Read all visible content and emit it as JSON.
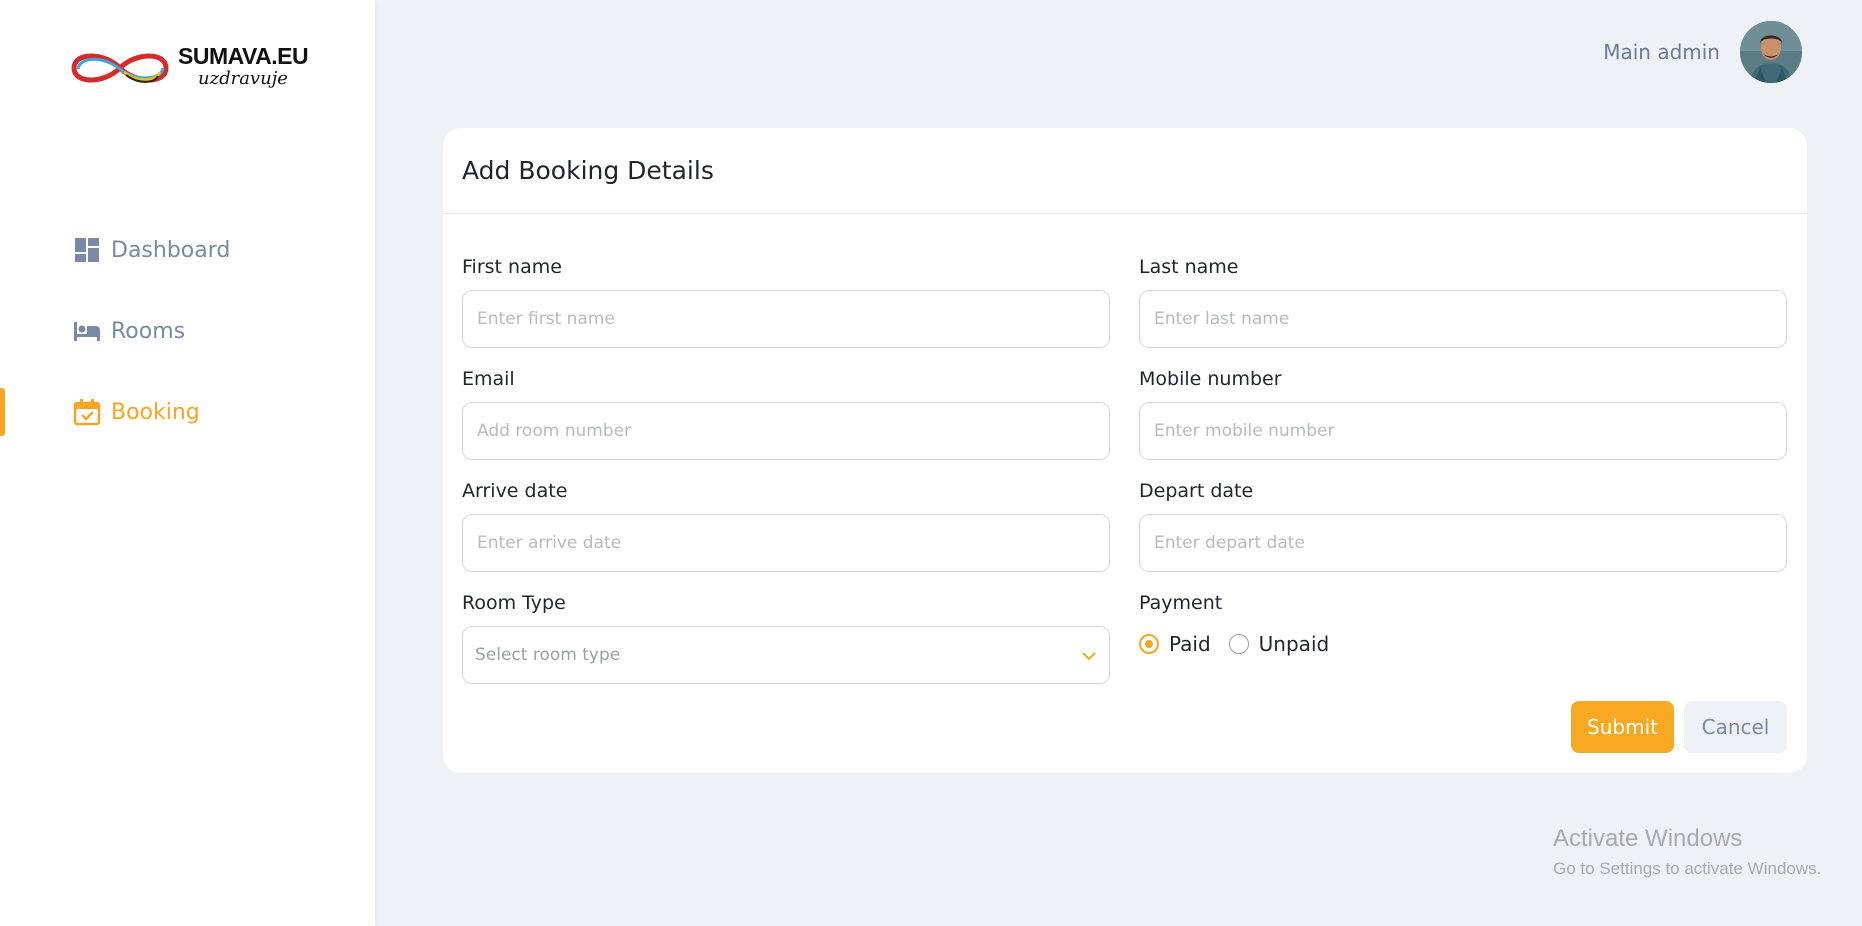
{
  "brand": {
    "title": "SUMAVA.EU",
    "subtitle": "uzdravuje"
  },
  "sidebar": {
    "items": [
      {
        "label": "Dashboard",
        "icon": "dashboard-icon",
        "active": false
      },
      {
        "label": "Rooms",
        "icon": "bed-icon",
        "active": false
      },
      {
        "label": "Booking",
        "icon": "calendar-check-icon",
        "active": true
      }
    ]
  },
  "header": {
    "user_name": "Main admin"
  },
  "form": {
    "title": "Add Booking Details",
    "first_name": {
      "label": "First name",
      "placeholder": "Enter first name"
    },
    "last_name": {
      "label": "Last name",
      "placeholder": "Enter last name"
    },
    "email": {
      "label": "Email",
      "placeholder": "Add room number"
    },
    "mobile": {
      "label": "Mobile number",
      "placeholder": "Enter mobile number"
    },
    "arrive": {
      "label": "Arrive date",
      "placeholder": "Enter arrive date"
    },
    "depart": {
      "label": "Depart date",
      "placeholder": "Enter depart date"
    },
    "room_type": {
      "label": "Room Type",
      "placeholder": "Select room type"
    },
    "payment": {
      "label": "Payment",
      "options": [
        "Paid",
        "Unpaid"
      ],
      "selected": "Paid"
    },
    "submit_label": "Submit",
    "cancel_label": "Cancel"
  },
  "watermark": {
    "title": "Activate Windows",
    "subtitle": "Go to Settings to activate Windows."
  },
  "colors": {
    "accent": "#f5a623",
    "nav_text": "#7a89a8",
    "background": "#eef1f5"
  }
}
